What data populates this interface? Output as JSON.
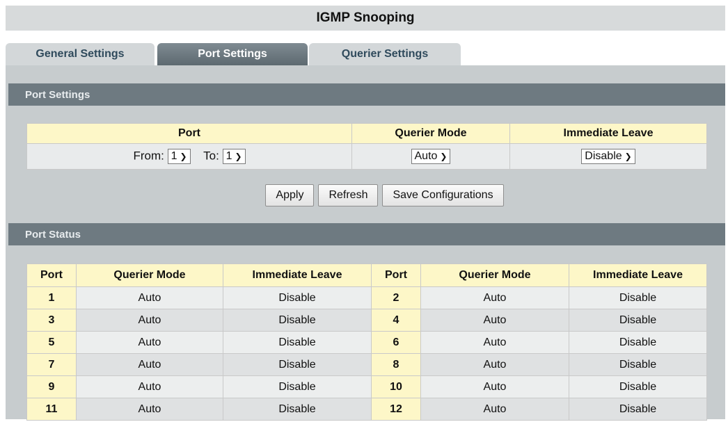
{
  "title": "IGMP Snooping",
  "tabs": [
    {
      "label": "General Settings",
      "active": false
    },
    {
      "label": "Port Settings",
      "active": true
    },
    {
      "label": "Querier Settings",
      "active": false
    }
  ],
  "port_settings": {
    "heading": "Port Settings",
    "headers": {
      "port": "Port",
      "querier_mode": "Querier Mode",
      "immediate_leave": "Immediate Leave"
    },
    "from_label": "From:",
    "from_value": "1",
    "to_label": "To:",
    "to_value": "1",
    "querier_mode_value": "Auto",
    "immediate_leave_value": "Disable"
  },
  "buttons": {
    "apply": "Apply",
    "refresh": "Refresh",
    "save": "Save Configurations"
  },
  "port_status": {
    "heading": "Port Status",
    "headers": [
      "Port",
      "Querier Mode",
      "Immediate Leave",
      "Port",
      "Querier Mode",
      "Immediate Leave"
    ],
    "rows": [
      [
        "1",
        "Auto",
        "Disable",
        "2",
        "Auto",
        "Disable"
      ],
      [
        "3",
        "Auto",
        "Disable",
        "4",
        "Auto",
        "Disable"
      ],
      [
        "5",
        "Auto",
        "Disable",
        "6",
        "Auto",
        "Disable"
      ],
      [
        "7",
        "Auto",
        "Disable",
        "8",
        "Auto",
        "Disable"
      ],
      [
        "9",
        "Auto",
        "Disable",
        "10",
        "Auto",
        "Disable"
      ],
      [
        "11",
        "Auto",
        "Disable",
        "12",
        "Auto",
        "Disable"
      ]
    ]
  },
  "colors": {
    "header_yellow": "#fdf7c8",
    "section_bar": "#6e7a81",
    "panel": "#c7ccce",
    "active_tab": "#5d6970"
  }
}
